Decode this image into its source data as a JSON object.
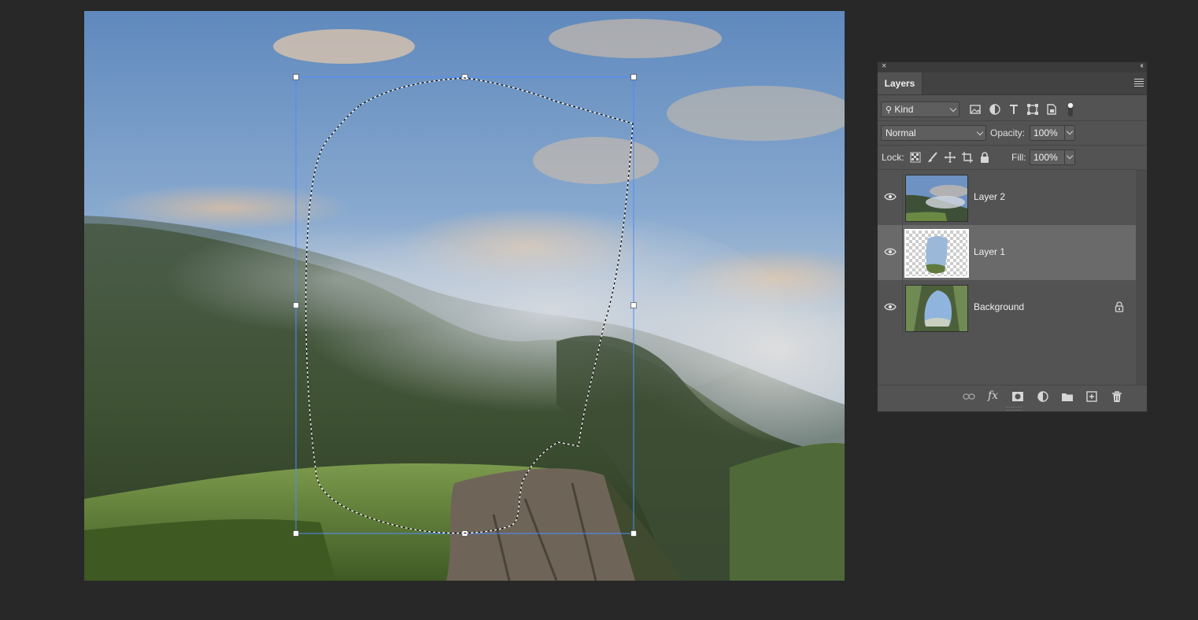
{
  "panel": {
    "tab_label": "Layers",
    "filter": {
      "kind_label": "Kind"
    },
    "blend_mode": "Normal",
    "opacity_label": "Opacity:",
    "opacity_value": "100%",
    "lock_label": "Lock:",
    "fill_label": "Fill:",
    "fill_value": "100%",
    "layers": [
      {
        "name": "Layer 2",
        "visible": true,
        "selected": false,
        "locked": false
      },
      {
        "name": "Layer 1",
        "visible": true,
        "selected": true,
        "locked": false
      },
      {
        "name": "Background",
        "visible": true,
        "selected": false,
        "locked": true
      }
    ]
  },
  "icons": {
    "filter": [
      "search-icon",
      "image-filter-icon",
      "adjustment-filter-icon",
      "type-filter-icon",
      "shape-filter-icon",
      "smart-object-filter-icon",
      "filter-toggle-icon"
    ],
    "lock": [
      "lock-transparent-icon",
      "lock-paint-icon",
      "lock-position-icon",
      "lock-artboard-icon",
      "lock-all-icon"
    ],
    "footer": [
      "link-layers-icon",
      "fx-icon",
      "layer-mask-icon",
      "adjustment-layer-icon",
      "new-group-icon",
      "new-layer-icon",
      "delete-layer-icon"
    ]
  },
  "colors": {
    "app_background": "#282828",
    "panel_background": "#535353",
    "selected_row": "#6a6a6a",
    "transform_box": "#4d8cff"
  }
}
